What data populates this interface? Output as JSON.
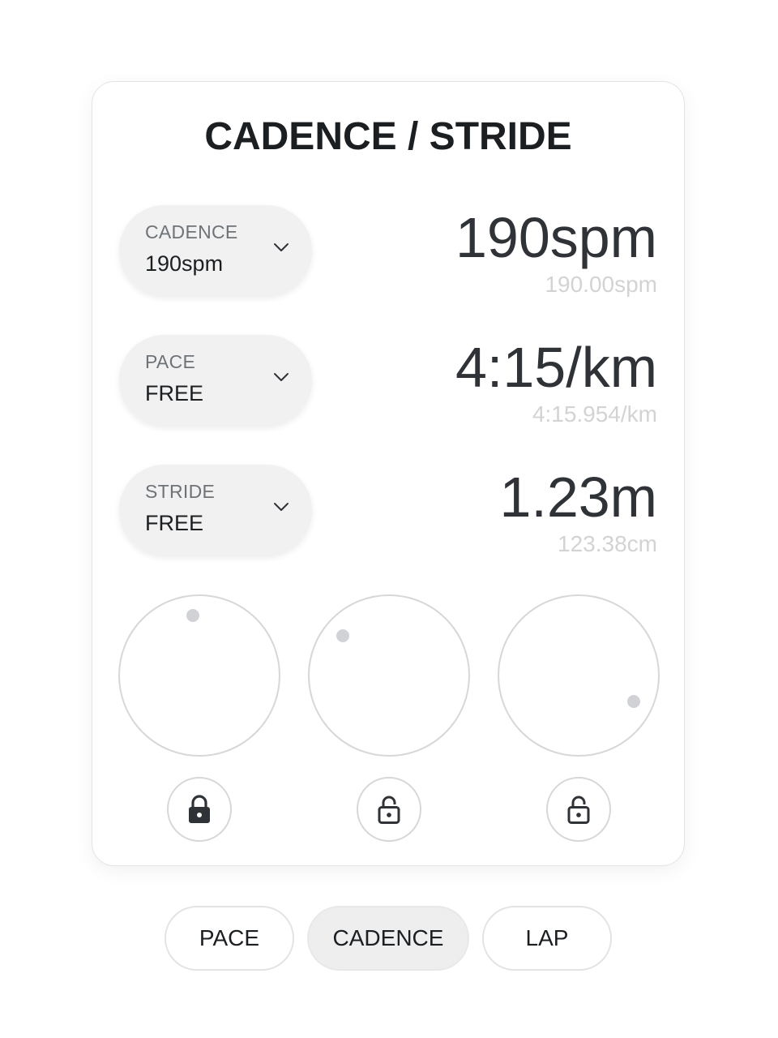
{
  "title": "CADENCE / STRIDE",
  "rows": [
    {
      "label": "CADENCE",
      "value": "190spm",
      "big": "190spm",
      "small": "190.00spm"
    },
    {
      "label": "PACE",
      "value": "FREE",
      "big": "4:15/km",
      "small": "4:15.954/km"
    },
    {
      "label": "STRIDE",
      "value": "FREE",
      "big": "1.23m",
      "small": "123.38cm"
    }
  ],
  "locks": [
    {
      "icon": "lock-closed-icon",
      "locked": true
    },
    {
      "icon": "lock-open-icon",
      "locked": false
    },
    {
      "icon": "lock-open-icon",
      "locked": false
    }
  ],
  "tabs": [
    "PACE",
    "CADENCE",
    "LAP"
  ],
  "active_tab": "CADENCE"
}
